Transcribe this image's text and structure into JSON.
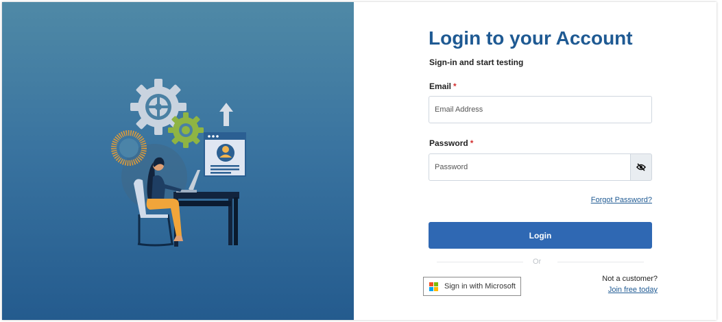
{
  "form": {
    "title": "Login to your Account",
    "subtitle": "Sign-in and start testing",
    "email_label": "Email",
    "email_placeholder": "Email Address",
    "email_value": "",
    "password_label": "Password",
    "password_placeholder": "Password",
    "password_value": "",
    "required_marker": "*",
    "forgot_password": "Forgot Password?",
    "login_button": "Login",
    "divider_text": "Or"
  },
  "sso": {
    "microsoft_label": "Sign in with Microsoft",
    "icon": "microsoft-logo-icon"
  },
  "signup": {
    "prompt": "Not a customer?",
    "link": "Join free today"
  },
  "icons": {
    "password_toggle": "eye-slash-icon"
  },
  "colors": {
    "brand": "#1f5a93",
    "button": "#2f68b3",
    "required": "#d32f2f",
    "panel_top": "#4f89a6",
    "panel_bottom": "#245b8e"
  }
}
